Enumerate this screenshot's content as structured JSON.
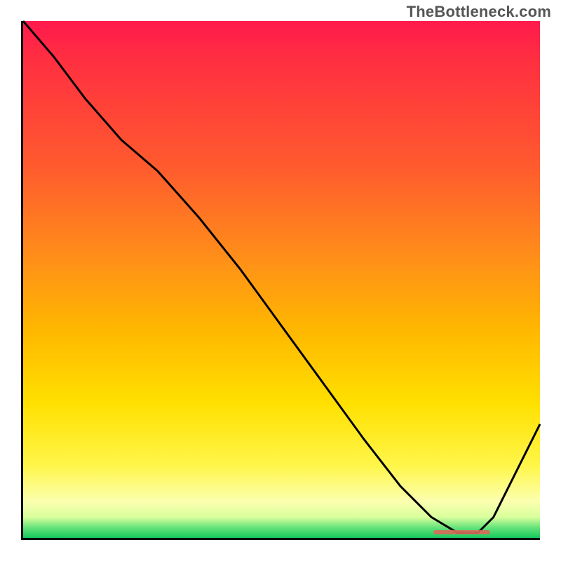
{
  "watermark": "TheBottleneck.com",
  "colors": {
    "top": "#ff1a4d",
    "mid_orange": "#ff8c1a",
    "mid_yellow": "#ffe000",
    "bottom_green": "#16c95e",
    "curve_stroke": "#000000",
    "marker": "#d86a5a"
  },
  "chart_data": {
    "type": "line",
    "title": "",
    "xlabel": "",
    "ylabel": "",
    "xlim": [
      0,
      100
    ],
    "ylim": [
      0,
      100
    ],
    "grid": false,
    "legend": false,
    "series": [
      {
        "name": "curve",
        "x": [
          0,
          6,
          12,
          19,
          26,
          34,
          42,
          50,
          58,
          66,
          73,
          79,
          84,
          88,
          91,
          94,
          97,
          100
        ],
        "y": [
          100,
          93,
          85,
          77,
          71,
          62,
          52,
          41,
          30,
          19,
          10,
          4,
          1,
          1,
          4,
          10,
          16,
          22
        ]
      }
    ],
    "annotations": [
      {
        "name": "bottom-marker",
        "x_start": 79,
        "x_end": 90,
        "y": 0.6
      }
    ],
    "notes": "Axis is unlabeled in the source image; x and y are normalized 0-100. Curve descends from top-left, minimum near x≈86, then rises toward the right edge. A short salmon-colored horizontal marker sits on the x-axis under the curve minimum."
  }
}
